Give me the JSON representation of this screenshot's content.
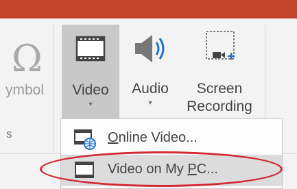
{
  "ribbon": {
    "symbol_label": "ymbol",
    "group_fragment": "s",
    "video_label": "Video",
    "audio_label": "Audio",
    "screen_recording_line1": "Screen",
    "screen_recording_line2": "Recording",
    "caret": "▾"
  },
  "menu": {
    "online_video": {
      "accel": "O",
      "rest": "nline Video..."
    },
    "video_on_pc": {
      "prefix": "Video on My ",
      "accel": "P",
      "suffix": "C..."
    }
  },
  "colors": {
    "titlebar": "#c0432a",
    "annotation_oval": "#d22a33",
    "selected_button": "#c8c8c8"
  }
}
